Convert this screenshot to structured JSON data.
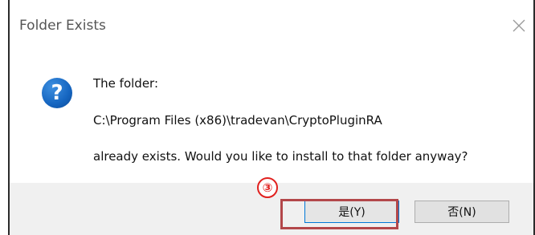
{
  "window": {
    "title": "Folder Exists",
    "close_icon": "close-icon"
  },
  "message": {
    "icon": "question-icon",
    "icon_glyph": "?",
    "line1": "The folder:",
    "path": "C:\\Program Files (x86)\\tradevan\\CryptoPluginRA",
    "line3": "already exists. Would you like to install to that folder anyway?"
  },
  "buttons": {
    "yes_label": "是(Y)",
    "no_label": "否(N)"
  },
  "annotation": {
    "step_marker": "③",
    "highlight_color": "#b3474a",
    "marker_color": "#e1201e"
  },
  "colors": {
    "icon_blue": "#1565c0",
    "footer_bg": "#f0f0f0"
  }
}
